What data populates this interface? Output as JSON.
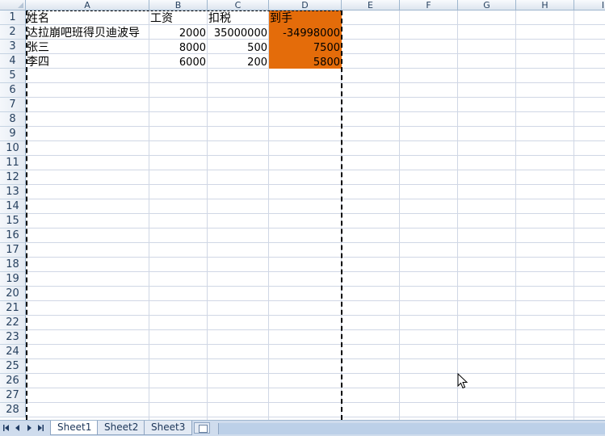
{
  "spreadsheet": {
    "columns": [
      "A",
      "B",
      "C",
      "D",
      "E",
      "F",
      "G",
      "H",
      "I"
    ],
    "row_numbers": [
      "1",
      "2",
      "3",
      "4",
      "5",
      "6",
      "7",
      "8",
      "9",
      "10",
      "11",
      "12",
      "13",
      "14",
      "15",
      "16",
      "17",
      "18",
      "19",
      "20",
      "21",
      "22",
      "23",
      "24",
      "25",
      "26",
      "27",
      "28"
    ],
    "rows": [
      {
        "name": "姓名",
        "salary": "工资",
        "tax": "扣税",
        "net": "到手"
      },
      {
        "name": "达拉崩吧班得贝迪波导",
        "salary": "2000",
        "tax": "35000000",
        "net": "-34998000"
      },
      {
        "name": "张三",
        "salary": "8000",
        "tax": "500",
        "net": "7500"
      },
      {
        "name": "李四",
        "salary": "6000",
        "tax": "200",
        "net": "5800"
      }
    ],
    "highlight_color": "#e46c0a"
  },
  "sheet_tabs": [
    {
      "label": "Sheet1",
      "active": true
    },
    {
      "label": "Sheet2",
      "active": false
    },
    {
      "label": "Sheet3",
      "active": false
    }
  ],
  "nav_icons": [
    "first-sheet-icon",
    "prev-sheet-icon",
    "next-sheet-icon",
    "last-sheet-icon"
  ]
}
